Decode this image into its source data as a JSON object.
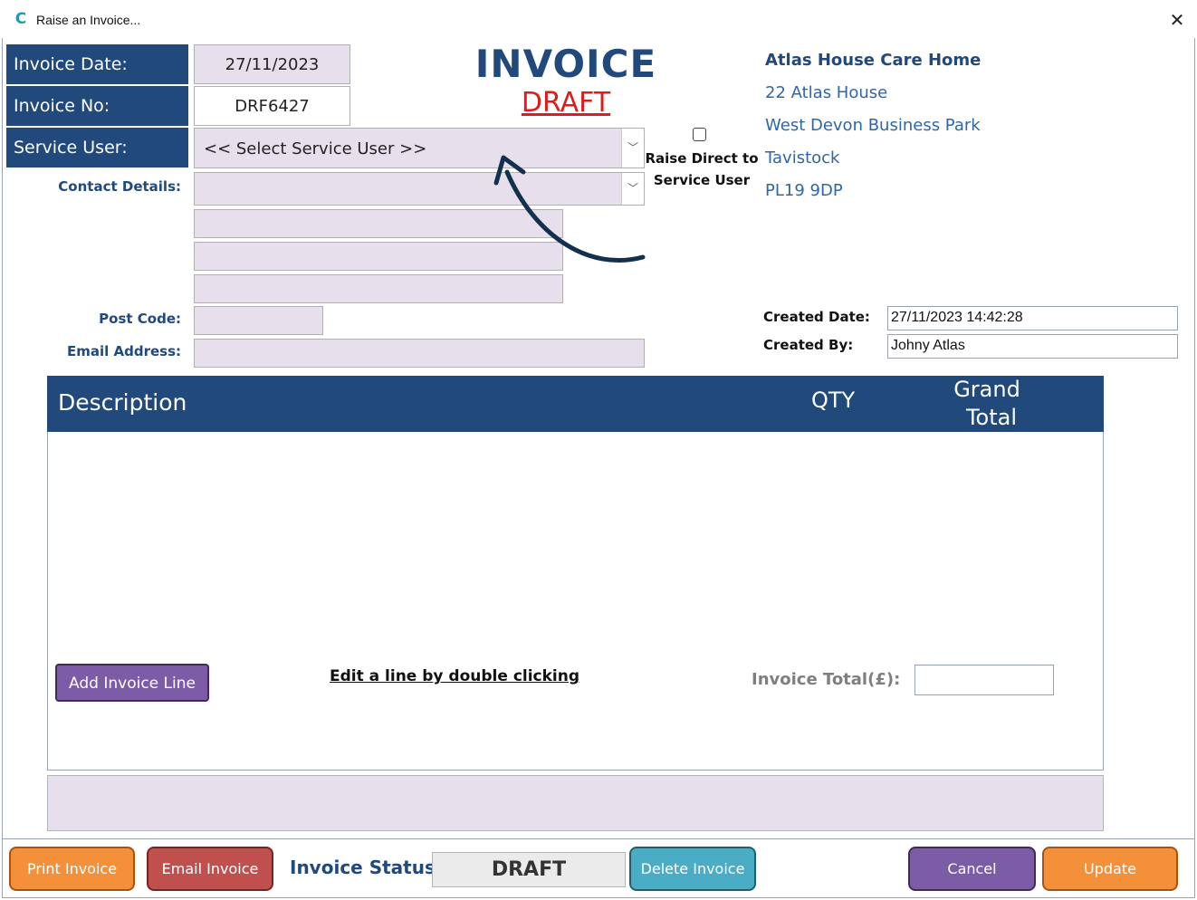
{
  "window": {
    "title": "Raise an Invoice...",
    "app_icon_glyph": "C",
    "close_glyph": "✕"
  },
  "header": {
    "invoice_date_label": "Invoice Date:",
    "invoice_date_value": "27/11/2023",
    "invoice_no_label": "Invoice No:",
    "invoice_no_value": "DRF6427",
    "service_user_label": "Service User:",
    "service_user_value": "<< Select Service User >>",
    "contact_details_label": "Contact Details:",
    "post_code_label": "Post Code:",
    "email_label": "Email Address:",
    "invoice_title": "INVOICE",
    "draft_title": "DRAFT",
    "raise_direct_label_1": "Raise Direct to",
    "raise_direct_label_2": "Service User"
  },
  "company_address": [
    "Atlas House Care Home",
    "22 Atlas House",
    "West Devon Business Park",
    "Tavistock",
    "PL19 9DP"
  ],
  "meta": {
    "created_date_label": "Created Date:",
    "created_date_value": "27/11/2023 14:42:28",
    "created_by_label": "Created By:",
    "created_by_value": "Johny Atlas"
  },
  "lines_table": {
    "col_description": "Description",
    "col_qty": "QTY",
    "col_grand_1": "Grand",
    "col_grand_2": "Total",
    "add_line_label": "Add Invoice Line",
    "edit_hint": "Edit a line by double clicking",
    "total_label": "Invoice Total(£):",
    "total_value": ""
  },
  "footer": {
    "print_label": "Print Invoice",
    "email_label": "Email Invoice",
    "status_label": "Invoice Status:",
    "status_value": "DRAFT",
    "delete_label": "Delete Invoice",
    "cancel_label": "Cancel",
    "update_label": "Update"
  },
  "colors": {
    "navy": "#21497c",
    "field_fill": "#e7e0ec",
    "draft_red": "#e01b1b",
    "orange": "#f5903a",
    "red": "#c0504d",
    "teal": "#4bacc6",
    "purple": "#7c5ca6"
  }
}
